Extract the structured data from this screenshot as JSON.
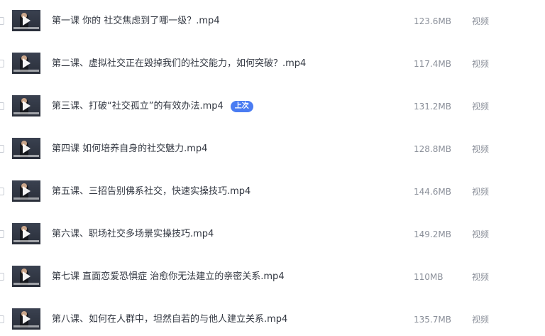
{
  "files": [
    {
      "name": "第一课 你的 社交焦虑到了哪一级？.mp4",
      "size": "123.6MB",
      "type": "视频",
      "badge": ""
    },
    {
      "name": "第二课、虚拟社交正在毁掉我们的社交能力，如何突破？.mp4",
      "size": "117.4MB",
      "type": "视频",
      "badge": ""
    },
    {
      "name": "第三课、打破“社交孤立”的有效办法.mp4",
      "size": "131.2MB",
      "type": "视频",
      "badge": "上次"
    },
    {
      "name": "第四课 如何培养自身的社交魅力.mp4",
      "size": "128.8MB",
      "type": "视频",
      "badge": ""
    },
    {
      "name": "第五课、三招告别佛系社交，快速实操技巧.mp4",
      "size": "144.6MB",
      "type": "视频",
      "badge": ""
    },
    {
      "name": "第六课、职场社交多场景实操技巧.mp4",
      "size": "149.2MB",
      "type": "视频",
      "badge": ""
    },
    {
      "name": "第七课 直面恋爱恐惧症 治愈你无法建立的亲密关系.mp4",
      "size": "110MB",
      "type": "视频",
      "badge": ""
    },
    {
      "name": "第八课、如何在人群中，坦然自若的与他人建立关系.mp4",
      "size": "135.7MB",
      "type": "视频",
      "badge": ""
    }
  ],
  "colors": {
    "badge_bg": "#4a7cf2",
    "text_primary": "#333842",
    "text_secondary": "#8a8f99"
  }
}
